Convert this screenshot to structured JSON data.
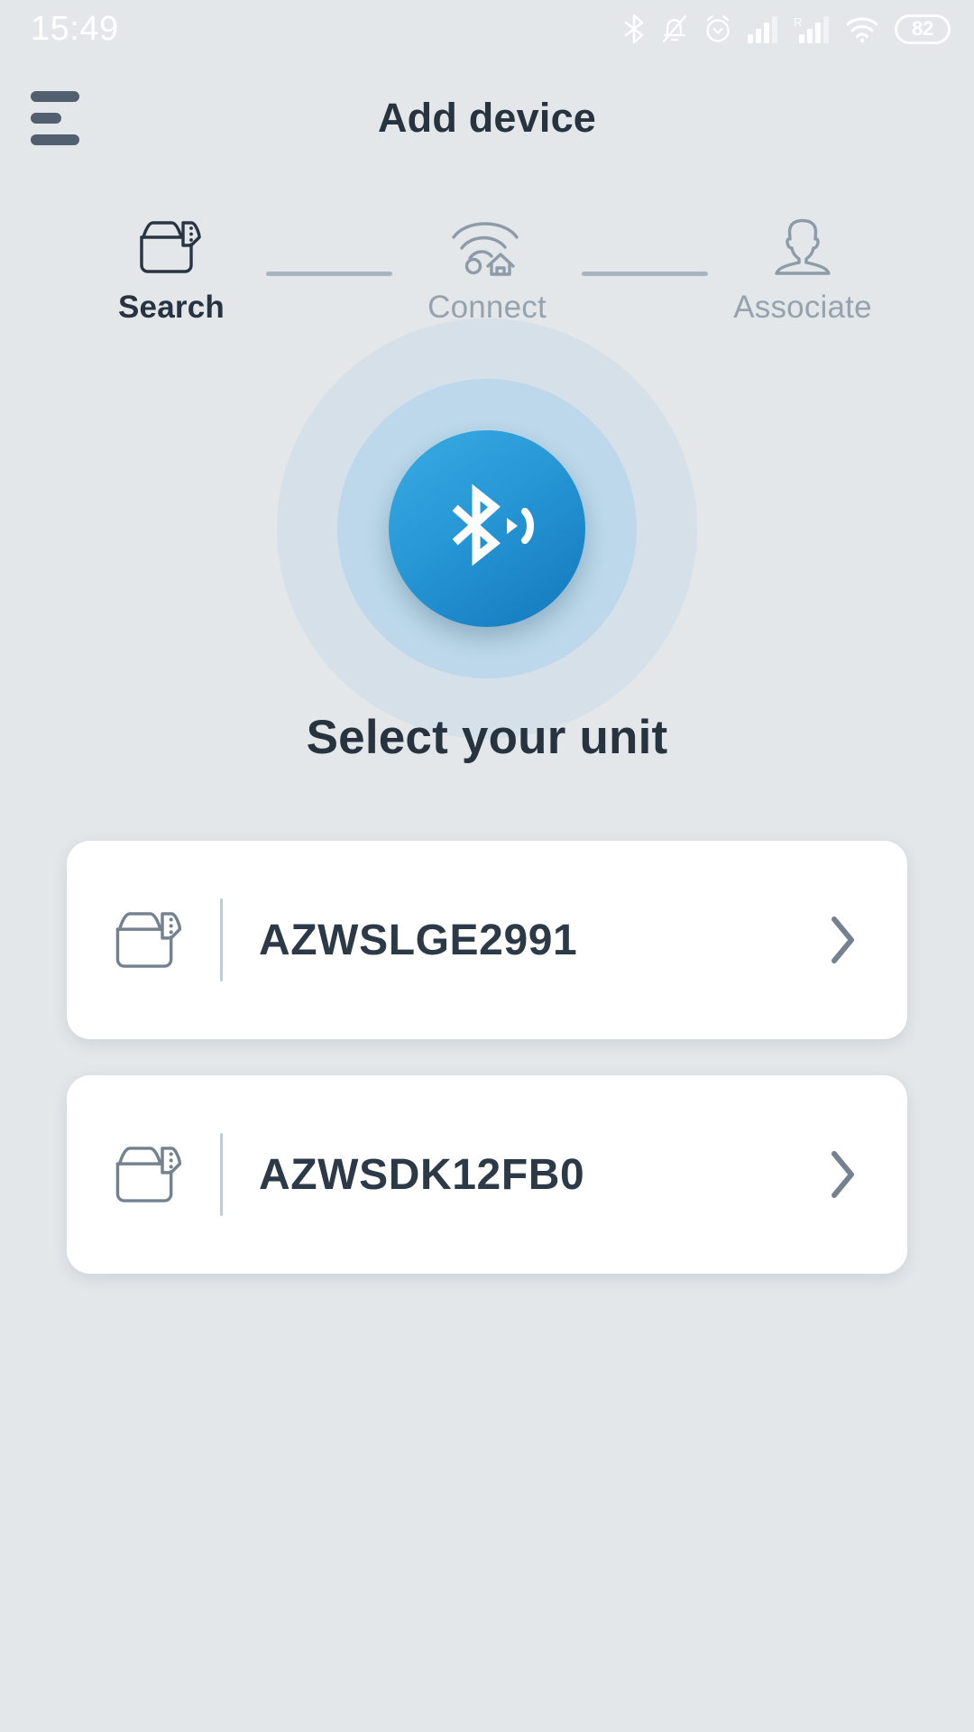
{
  "statusbar": {
    "time": "15:49",
    "icons": [
      "bluetooth-icon",
      "bell-muted-icon",
      "alarm-clock-icon",
      "signal-bars-icon",
      "signal-bars-roaming-icon",
      "wifi-icon"
    ],
    "battery_level": "82"
  },
  "appbar": {
    "menu_icon": "hamburger-menu-icon",
    "title": "Add device"
  },
  "stepper": {
    "steps": [
      {
        "label": "Search",
        "icon": "device-unit-icon",
        "state": "active"
      },
      {
        "label": "Connect",
        "icon": "wifi-house-icon",
        "state": "idle"
      },
      {
        "label": "Associate",
        "icon": "person-icon",
        "state": "idle"
      }
    ]
  },
  "scanner": {
    "icon": "bluetooth-broadcast-icon",
    "accent_color": "#2797d6",
    "ring_mid_color": "#bcd8ea",
    "ring_outer_color": "#d5e0e8"
  },
  "main": {
    "heading": "Select your unit",
    "devices": [
      {
        "name": "AZWSLGE2991",
        "icon": "device-unit-icon",
        "chevron": "chevron-right-icon"
      },
      {
        "name": "AZWSDK12FB0",
        "icon": "device-unit-icon",
        "chevron": "chevron-right-icon"
      }
    ]
  },
  "theme": {
    "background": "#e3e7ea",
    "card_background": "#ffffff",
    "text_primary": "#27333f",
    "text_muted": "#95a3ae"
  }
}
